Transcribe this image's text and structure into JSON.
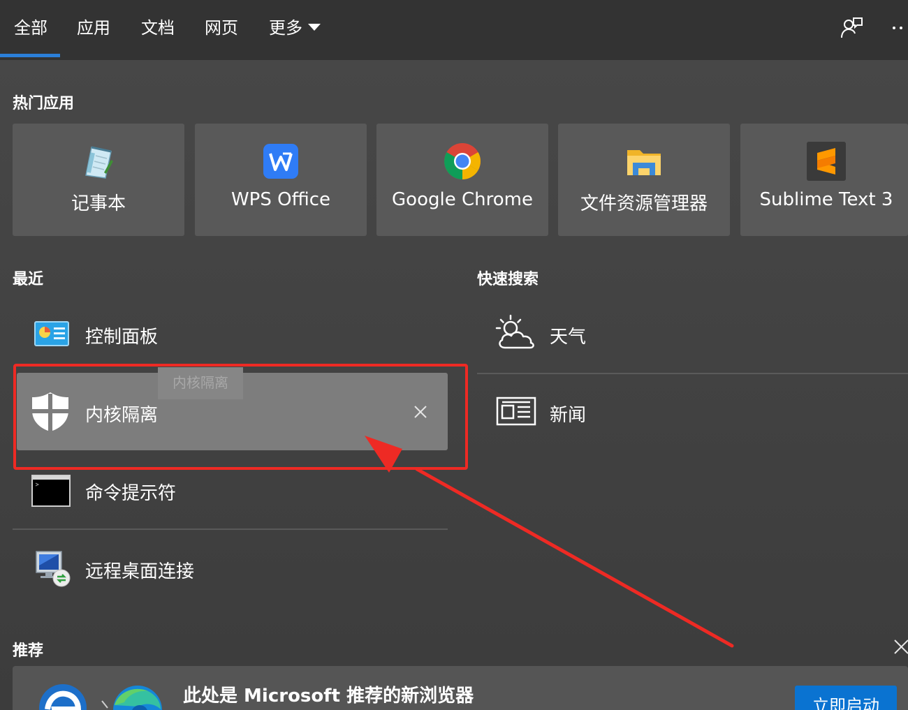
{
  "tabs": [
    {
      "label": "全部",
      "active": true
    },
    {
      "label": "应用",
      "active": false
    },
    {
      "label": "文档",
      "active": false
    },
    {
      "label": "网页",
      "active": false
    },
    {
      "label": "更多",
      "active": false
    }
  ],
  "topbar_icons": [
    "feedback-person-icon",
    "more-ellipsis-icon"
  ],
  "sections": {
    "popular_apps": "热门应用",
    "recent": "最近",
    "quick_search": "快速搜索",
    "recommended": "推荐"
  },
  "popular_apps": [
    {
      "label": "记事本",
      "icon": "notepad-icon"
    },
    {
      "label": "WPS Office",
      "icon": "wps-office-icon"
    },
    {
      "label": "Google Chrome",
      "icon": "chrome-icon"
    },
    {
      "label": "文件资源管理器",
      "icon": "file-explorer-icon"
    },
    {
      "label": "Sublime Text 3",
      "icon": "sublime-text-icon"
    }
  ],
  "recent": [
    {
      "label": "控制面板",
      "icon": "control-panel-icon"
    },
    {
      "label": "内核隔离",
      "icon": "windows-security-shield-icon",
      "highlighted": true
    },
    {
      "label": "命令提示符",
      "icon": "command-prompt-icon"
    },
    {
      "label": "远程桌面连接",
      "icon": "remote-desktop-icon"
    }
  ],
  "tooltip": "内核隔离",
  "quick_search": [
    {
      "label": "天气",
      "icon": "weather-icon"
    },
    {
      "label": "新闻",
      "icon": "news-icon"
    }
  ],
  "recommendation": {
    "title": "此处是 Microsoft 推荐的新浏览器",
    "button": "立即启动"
  },
  "colors": {
    "accent": "#2b7fd9",
    "annotation": "#ee2a24",
    "button": "#0a73d1"
  }
}
